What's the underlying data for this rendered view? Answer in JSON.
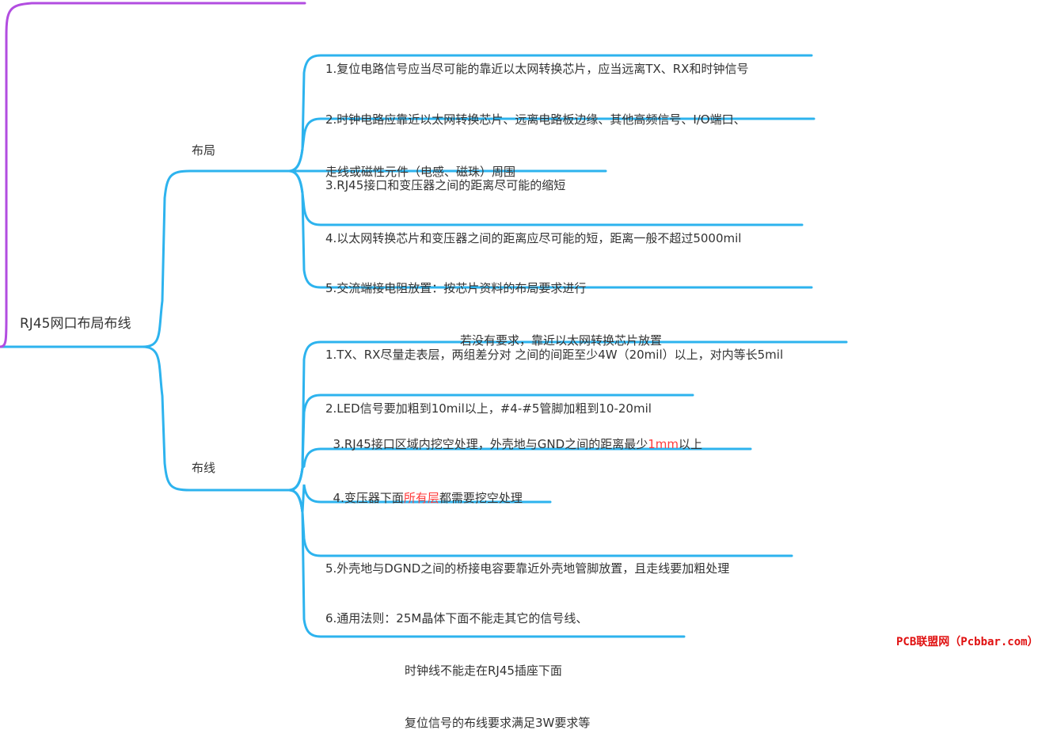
{
  "root": {
    "label": "RJ45网口布局布线"
  },
  "colors": {
    "branch": "#2db3ee",
    "top_branch": "#b24de0",
    "highlight": "#ff3b3b",
    "watermark": "#e01010"
  },
  "branches": [
    {
      "label": "布局",
      "items": [
        {
          "lines": [
            "1.复位电路信号应当尽可能的靠近以太网转换芯片，应当远离TX、RX和时钟信号"
          ]
        },
        {
          "lines": [
            "2.时钟电路应靠近以太网转换芯片、远离电路板边缘、其他高频信号、I/O端口、",
            "走线或磁性元件（电感、磁珠）周围"
          ]
        },
        {
          "lines": [
            "3.RJ45接口和变压器之间的距离尽可能的缩短"
          ]
        },
        {
          "lines": [
            "4.以太网转换芯片和变压器之间的距离应尽可能的短，距离一般不超过5000mil"
          ]
        },
        {
          "lines": [
            "5.交流端接电阻放置：按芯片资料的布局要求进行",
            "若没有要求，靠近以太网转换芯片放置"
          ]
        }
      ]
    },
    {
      "label": "布线",
      "items": [
        {
          "lines": [
            "1.TX、RX尽量走表层，两组差分对 之间的间距至少4W（20mil）以上，对内等长5mil"
          ]
        },
        {
          "lines": [
            "2.LED信号要加粗到10mil以上，#4-#5管脚加粗到10-20mil"
          ]
        },
        {
          "parts": [
            {
              "text": "3.RJ45接口区域内挖空处理，外壳地与GND之间的距离最少"
            },
            {
              "text": "1mm",
              "highlight": true
            },
            {
              "text": "以上"
            }
          ]
        },
        {
          "parts": [
            {
              "text": "4.变压器下面"
            },
            {
              "text": "所有层",
              "highlight": true
            },
            {
              "text": "都需要挖空处理"
            }
          ]
        },
        {
          "lines": [
            "5.外壳地与DGND之间的桥接电容要靠近外壳地管脚放置，且走线要加粗处理"
          ]
        },
        {
          "lines": [
            "6.通用法则：25M晶体下面不能走其它的信号线、",
            "时钟线不能走在RJ45插座下面",
            "复位信号的布线要求满足3W要求等"
          ]
        }
      ]
    }
  ],
  "watermark": "PCB联盟网（Pcbbar.com）"
}
